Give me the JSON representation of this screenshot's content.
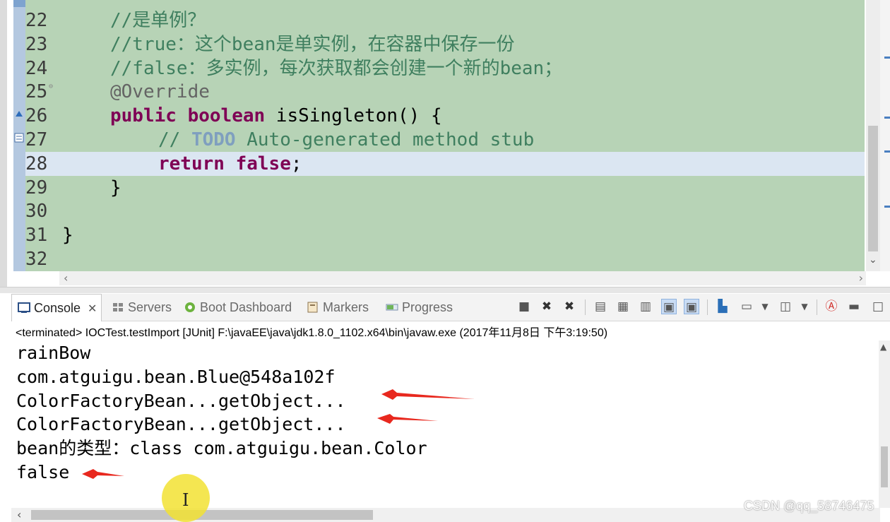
{
  "editor": {
    "lines": [
      {
        "num": "22",
        "indent": 1,
        "tokens": [
          {
            "t": "//是单例？",
            "c": "cm"
          }
        ]
      },
      {
        "num": "23",
        "indent": 1,
        "tokens": [
          {
            "t": "//true：这个bean是单实例，在容器中保存一份",
            "c": "cm"
          }
        ]
      },
      {
        "num": "24",
        "indent": 1,
        "tokens": [
          {
            "t": "//false：多实例，每次获取都会创建一个新的bean；",
            "c": "cm"
          }
        ]
      },
      {
        "num": "25",
        "indent": 1,
        "tokens": [
          {
            "t": "@Override",
            "c": "ann"
          }
        ]
      },
      {
        "num": "26",
        "indent": 1,
        "tokens": [
          {
            "t": "public",
            "c": "kw"
          },
          {
            "t": " ",
            "c": ""
          },
          {
            "t": "boolean",
            "c": "kw"
          },
          {
            "t": " isSingleton() {",
            "c": ""
          }
        ]
      },
      {
        "num": "27",
        "indent": 2,
        "tokens": [
          {
            "t": "// ",
            "c": "cm"
          },
          {
            "t": "TODO",
            "c": "todo"
          },
          {
            "t": " Auto-generated method stub",
            "c": "cm"
          }
        ]
      },
      {
        "num": "28",
        "indent": 2,
        "current": true,
        "tokens": [
          {
            "t": "return",
            "c": "kw"
          },
          {
            "t": " ",
            "c": ""
          },
          {
            "t": "false",
            "c": "kw"
          },
          {
            "t": ";",
            "c": ""
          }
        ]
      },
      {
        "num": "29",
        "indent": 1,
        "tokens": [
          {
            "t": "}",
            "c": ""
          }
        ]
      },
      {
        "num": "30",
        "indent": 0,
        "tokens": []
      },
      {
        "num": "31",
        "indent": 0,
        "tokens": [
          {
            "t": "}",
            "c": ""
          }
        ]
      },
      {
        "num": "32",
        "indent": 0,
        "tokens": []
      }
    ]
  },
  "console_view": {
    "tabs": [
      {
        "label": "Console",
        "icon": "console-icon",
        "active": true
      },
      {
        "label": "Servers",
        "icon": "servers-icon"
      },
      {
        "label": "Boot Dashboard",
        "icon": "boot-dashboard-icon"
      },
      {
        "label": "Markers",
        "icon": "markers-icon"
      },
      {
        "label": "Progress",
        "icon": "progress-icon"
      }
    ],
    "status": "<terminated> IOCTest.testImport [JUnit] F:\\javaEE\\java\\jdk1.8.0_1102.x64\\bin\\javaw.exe (2017年11月8日 下午3:19:50)",
    "output": [
      "rainBow",
      "com.atguigu.bean.Blue@548a102f",
      "ColorFactoryBean...getObject...",
      "ColorFactoryBean...getObject...",
      "bean的类型：class com.atguigu.bean.Color",
      "false"
    ]
  },
  "colors": {
    "editor_bg": "#b7d3b6",
    "current_line": "#dbe6f2",
    "keyword": "#7f0055",
    "comment": "#3f7f5f",
    "annotation_arrow": "#e8281e",
    "cursor_highlight": "#f2e232"
  },
  "watermark": "CSDN @qq_58746475"
}
